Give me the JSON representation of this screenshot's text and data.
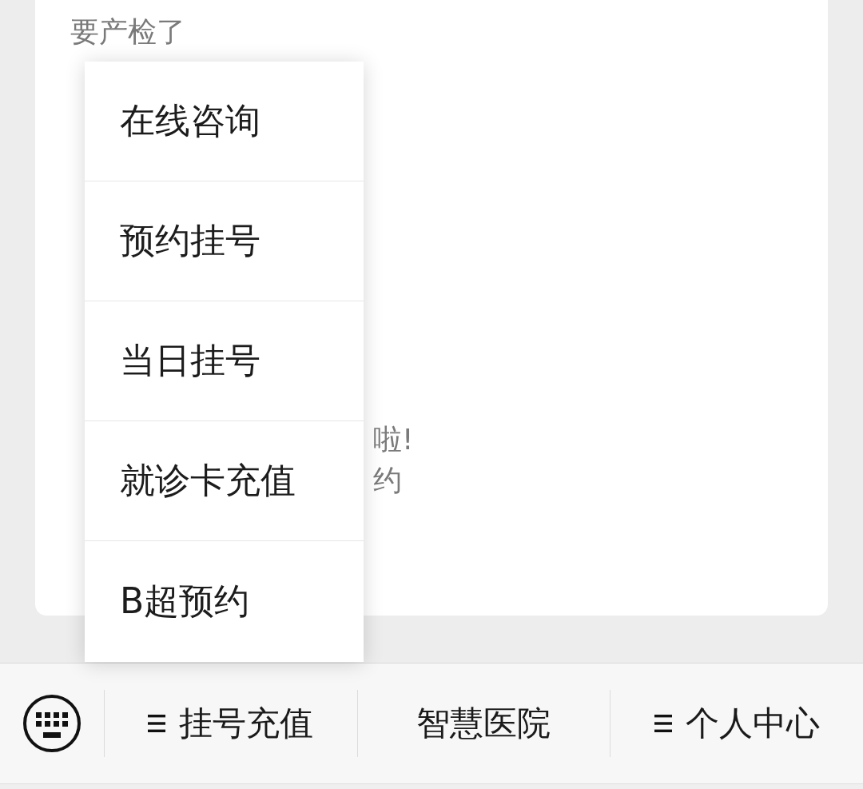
{
  "message_card": {
    "lines": [
      {
        "kind": "lead",
        "text": "要产检了"
      },
      {
        "kind": "tail",
        "text": "啦!"
      },
      {
        "kind": "tail",
        "text": "约"
      }
    ]
  },
  "bottom_menu": {
    "items": [
      {
        "label": "挂号充值",
        "has_submenu": true,
        "submenu": [
          "在线咨询",
          "预约挂号",
          "当日挂号",
          "就诊卡充值",
          "B超预约"
        ]
      },
      {
        "label": "智慧医院",
        "has_submenu": false
      },
      {
        "label": "个人中心",
        "has_submenu": true
      }
    ]
  }
}
